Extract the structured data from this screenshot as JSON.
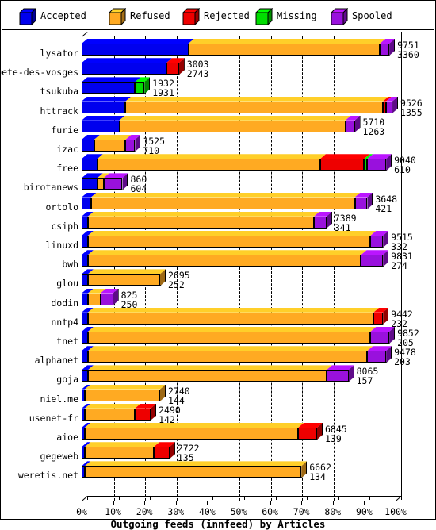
{
  "chart_data": {
    "type": "bar",
    "orientation": "horizontal",
    "stacked": true,
    "title": "Outgoing feeds (innfeed) by Articles",
    "xlabel": "Outgoing feeds (innfeed) by Articles",
    "ylabel": "",
    "xlim": [
      0,
      100
    ],
    "xtick_labels": [
      "0%",
      "10%",
      "20%",
      "30%",
      "40%",
      "50%",
      "60%",
      "70%",
      "80%",
      "90%",
      "100%"
    ],
    "xticks": [
      0,
      10,
      20,
      30,
      40,
      50,
      60,
      70,
      80,
      90,
      100
    ],
    "grid": true,
    "legend_position": "top",
    "legend": [
      "Accepted",
      "Refused",
      "Rejected",
      "Missing",
      "Spooled"
    ],
    "series_colors": {
      "Accepted": "#0000ee",
      "Refused": "#ffaa22",
      "Rejected": "#ee0000",
      "Missing": "#00dd00",
      "Spooled": "#9911dd"
    },
    "categories": [
      "lysator",
      "bete-des-vosges",
      "tsukuba",
      "httrack",
      "furie",
      "izac",
      "free",
      "birotanews",
      "ortolo",
      "csiph",
      "linuxd",
      "bwh",
      "glou",
      "dodin",
      "nntp4",
      "tnet",
      "alphanet",
      "goja",
      "niel.me",
      "usenet-fr",
      "aioe",
      "gegeweb",
      "weretis.net"
    ],
    "rows": [
      {
        "name": "lysator",
        "total": 9751,
        "second": 3360,
        "pct": {
          "Accepted": 34,
          "Refused": 61,
          "Rejected": 0,
          "Missing": 0,
          "Spooled": 3
        }
      },
      {
        "name": "bete-des-vosges",
        "total": 3003,
        "second": 2743,
        "pct": {
          "Accepted": 27,
          "Refused": 0,
          "Rejected": 4,
          "Missing": 0,
          "Spooled": 0
        }
      },
      {
        "name": "tsukuba",
        "total": 1932,
        "second": 1931,
        "pct": {
          "Accepted": 17,
          "Refused": 0,
          "Rejected": 0,
          "Missing": 3,
          "Spooled": 0
        }
      },
      {
        "name": "httrack",
        "total": 9526,
        "second": 1355,
        "pct": {
          "Accepted": 14,
          "Refused": 82,
          "Rejected": 1,
          "Missing": 0,
          "Spooled": 2
        }
      },
      {
        "name": "furie",
        "total": 5710,
        "second": 1263,
        "pct": {
          "Accepted": 12,
          "Refused": 72,
          "Rejected": 0,
          "Missing": 0,
          "Spooled": 3
        }
      },
      {
        "name": "izac",
        "total": 1525,
        "second": 710,
        "pct": {
          "Accepted": 4,
          "Refused": 10,
          "Rejected": 0,
          "Missing": 0,
          "Spooled": 3
        }
      },
      {
        "name": "free",
        "total": 9040,
        "second": 610,
        "pct": {
          "Accepted": 5,
          "Refused": 71,
          "Rejected": 14,
          "Missing": 1,
          "Spooled": 6
        }
      },
      {
        "name": "birotanews",
        "total": 860,
        "second": 604,
        "pct": {
          "Accepted": 5,
          "Refused": 2,
          "Rejected": 0,
          "Missing": 0,
          "Spooled": 6
        }
      },
      {
        "name": "ortolo",
        "total": 3648,
        "second": 421,
        "pct": {
          "Accepted": 3,
          "Refused": 84,
          "Rejected": 0,
          "Missing": 0,
          "Spooled": 4
        }
      },
      {
        "name": "csiph",
        "total": 7389,
        "second": 341,
        "pct": {
          "Accepted": 2,
          "Refused": 72,
          "Rejected": 0,
          "Missing": 0,
          "Spooled": 4
        }
      },
      {
        "name": "linuxd",
        "total": 9515,
        "second": 332,
        "pct": {
          "Accepted": 2,
          "Refused": 90,
          "Rejected": 0,
          "Missing": 0,
          "Spooled": 4
        }
      },
      {
        "name": "bwh",
        "total": 9831,
        "second": 274,
        "pct": {
          "Accepted": 2,
          "Refused": 87,
          "Rejected": 0,
          "Missing": 0,
          "Spooled": 7
        }
      },
      {
        "name": "glou",
        "total": 2695,
        "second": 252,
        "pct": {
          "Accepted": 2,
          "Refused": 23,
          "Rejected": 0,
          "Missing": 0,
          "Spooled": 0
        }
      },
      {
        "name": "dodin",
        "total": 825,
        "second": 250,
        "pct": {
          "Accepted": 2,
          "Refused": 4,
          "Rejected": 0,
          "Missing": 0,
          "Spooled": 4
        }
      },
      {
        "name": "nntp4",
        "total": 9442,
        "second": 232,
        "pct": {
          "Accepted": 2,
          "Refused": 91,
          "Rejected": 3,
          "Missing": 0,
          "Spooled": 0
        }
      },
      {
        "name": "tnet",
        "total": 9852,
        "second": 205,
        "pct": {
          "Accepted": 2,
          "Refused": 90,
          "Rejected": 0,
          "Missing": 0,
          "Spooled": 6
        }
      },
      {
        "name": "alphanet",
        "total": 9478,
        "second": 203,
        "pct": {
          "Accepted": 2,
          "Refused": 89,
          "Rejected": 0,
          "Missing": 0,
          "Spooled": 6
        }
      },
      {
        "name": "goja",
        "total": 8065,
        "second": 157,
        "pct": {
          "Accepted": 2,
          "Refused": 76,
          "Rejected": 0,
          "Missing": 0,
          "Spooled": 7
        }
      },
      {
        "name": "niel.me",
        "total": 2740,
        "second": 144,
        "pct": {
          "Accepted": 1,
          "Refused": 24,
          "Rejected": 0,
          "Missing": 0,
          "Spooled": 0
        }
      },
      {
        "name": "usenet-fr",
        "total": 2490,
        "second": 142,
        "pct": {
          "Accepted": 1,
          "Refused": 16,
          "Rejected": 5,
          "Missing": 0,
          "Spooled": 0
        }
      },
      {
        "name": "aioe",
        "total": 6845,
        "second": 139,
        "pct": {
          "Accepted": 1,
          "Refused": 68,
          "Rejected": 6,
          "Missing": 0,
          "Spooled": 0
        }
      },
      {
        "name": "gegeweb",
        "total": 2722,
        "second": 135,
        "pct": {
          "Accepted": 1,
          "Refused": 22,
          "Rejected": 5,
          "Missing": 0,
          "Spooled": 0
        }
      },
      {
        "name": "weretis.net",
        "total": 6662,
        "second": 134,
        "pct": {
          "Accepted": 1,
          "Refused": 69,
          "Rejected": 0,
          "Missing": 0,
          "Spooled": 0
        }
      }
    ]
  }
}
